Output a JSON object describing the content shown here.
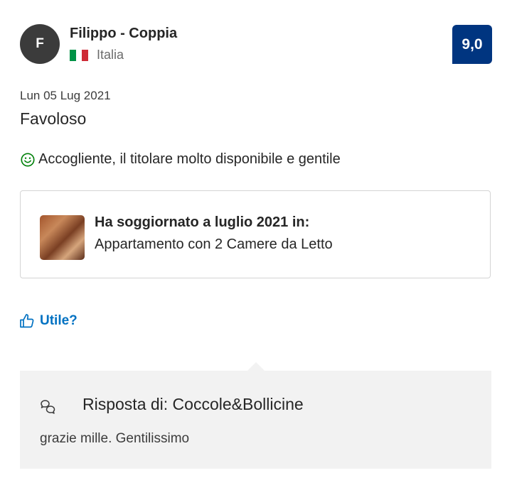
{
  "reviewer": {
    "initial": "F",
    "name": "Filippo - Coppia",
    "country": "Italia",
    "flag_colors": [
      "#009246",
      "#ffffff",
      "#ce2b37"
    ]
  },
  "score": "9,0",
  "review": {
    "date": "Lun 05 Lug 2021",
    "title": "Favoloso",
    "positive_icon": "smile-icon",
    "positive_text": "Accogliente, il titolare molto disponibile e gentile"
  },
  "stay": {
    "title": "Ha soggiornato a luglio 2021 in:",
    "room": "Appartamento con 2 Camere da Letto"
  },
  "helpful": {
    "icon": "thumbs-up-icon",
    "label": "Utile?"
  },
  "reply": {
    "icon": "chat-bubbles-icon",
    "title": "Risposta di: Coccole&Bollicine",
    "text": "grazie mille. Gentilissimo"
  },
  "colors": {
    "score_bg": "#003580",
    "link": "#0071c2",
    "positive": "#008009",
    "reply_bg": "#f2f2f2"
  }
}
